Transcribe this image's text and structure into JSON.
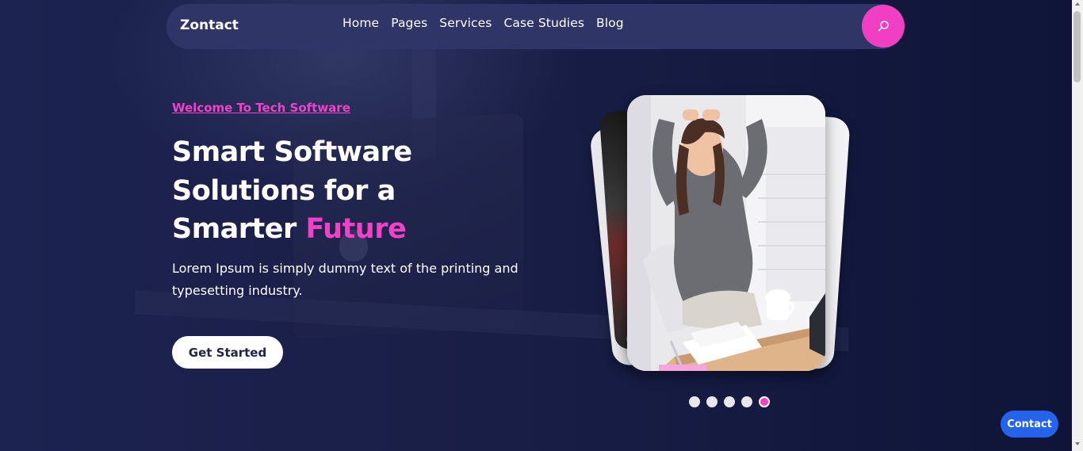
{
  "brand": {
    "logo": "Zontact"
  },
  "nav": {
    "items": [
      {
        "label": "Home"
      },
      {
        "label": "Pages"
      },
      {
        "label": "Services"
      },
      {
        "label": "Case Studies"
      },
      {
        "label": "Blog"
      }
    ],
    "search_icon": "search-icon"
  },
  "hero": {
    "kicker": "Welcome To Tech Software",
    "title_line1": "Smart Software",
    "title_line2": "Solutions for a",
    "title_line3_plain": "Smarter ",
    "title_line3_accent": "Future",
    "description": "Lorem Ipsum is simply dummy text of the printing and typesetting industry.",
    "cta_label": "Get Started"
  },
  "slider": {
    "total_slides": 5,
    "active_index": 4
  },
  "floating": {
    "contact_label": "Contact"
  },
  "colors": {
    "accent": "#f042c8",
    "nav_bg": "#2f3667",
    "page_bg": "#1c2147",
    "contact_blue": "#2563eb"
  }
}
